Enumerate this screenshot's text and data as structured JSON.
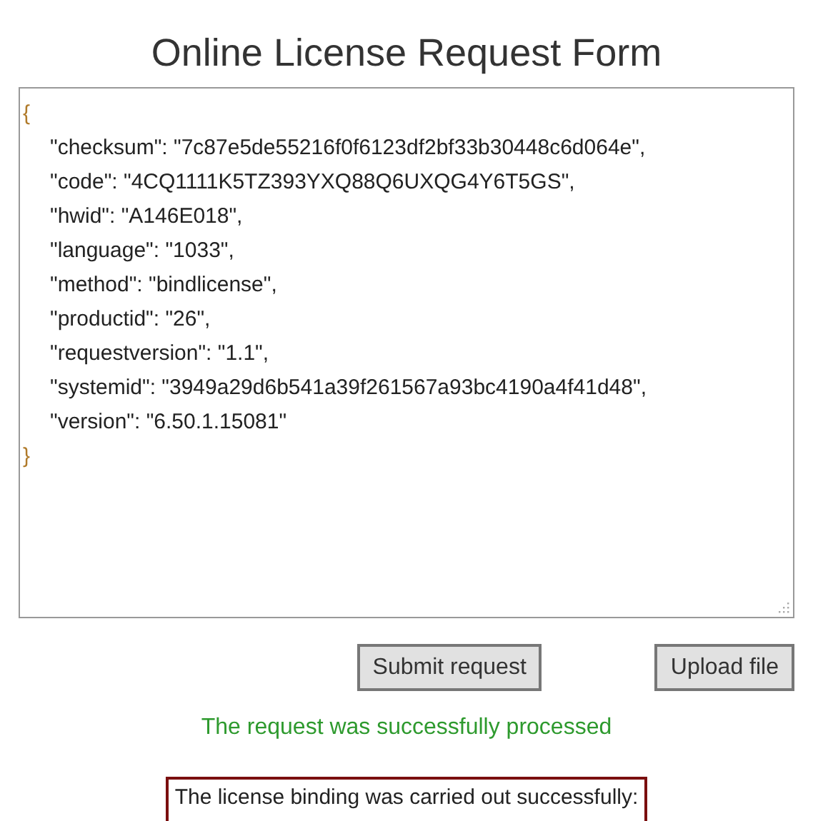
{
  "title": "Online License Request Form",
  "request_text": {
    "open": "{",
    "lines": [
      "\"checksum\": \"7c87e5de55216f0f6123df2bf33b30448c6d064e\",",
      "\"code\": \"4CQ1111K5TZ393YXQ88Q6UXQG4Y6T5GS\",",
      "\"hwid\": \"A146E018\",",
      "\"language\": \"1033\",",
      "\"method\": \"bindlicense\",",
      "\"productid\": \"26\",",
      "\"requestversion\": \"1.1\",",
      "\"systemid\": \"3949a29d6b541a39f261567a93bc4190a4f41d48\",",
      "\"version\": \"6.50.1.15081\""
    ],
    "close": "}"
  },
  "buttons": [
    "Submit request",
    "Upload file"
  ],
  "status_message": "The request was successfully processed",
  "result_message": "The license binding was carried out successfully:"
}
